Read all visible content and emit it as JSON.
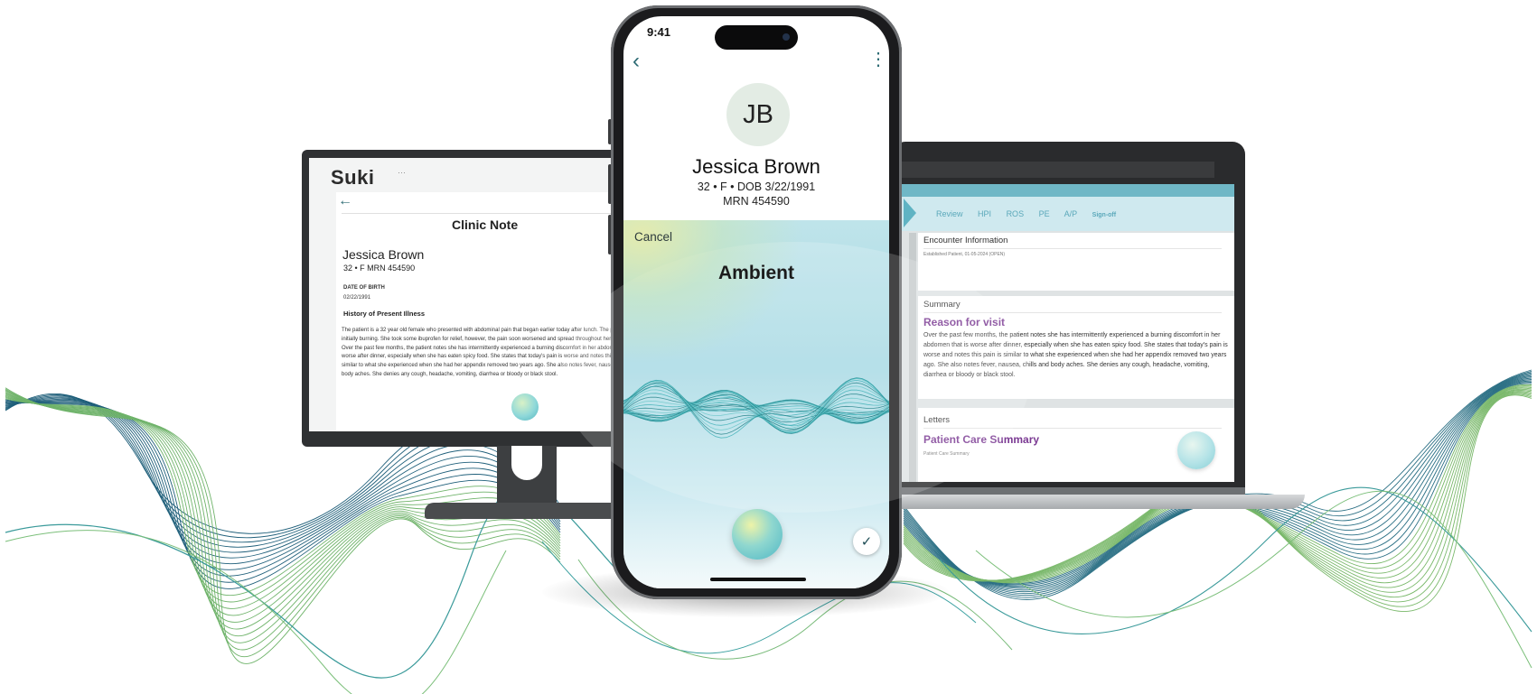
{
  "monitor": {
    "brand": "Suki",
    "menu_dots": "···",
    "note_title": "Clinic Note",
    "patient_name": "Jessica Brown",
    "patient_meta": "32 • F   MRN 454590",
    "dob_label": "DATE OF BIRTH",
    "dob_value": "02/22/1991",
    "section_title": "History of Present Illness",
    "section_body": "The patient is a 32 year old female who presented with abdominal pain that began earlier today after lunch. The pain was initially burning. She took some ibuprofen for relief, however, the pain soon worsened and spread throughout her abdomen. Over the past few months, the patient notes she has intermittently experienced a burning discomfort in her abdomen that is worse after dinner, especially when she has eaten spicy food. She states that today's pain is worse and notes this pain is similar to what she experienced when she had her appendix removed two years ago. She also notes fever, nausea, chills and body aches. She denies any cough, headache, vomiting, diarrhea or bloody or black stool."
  },
  "phone": {
    "status_time": "9:41",
    "avatar_initials": "JB",
    "patient_name": "Jessica Brown",
    "patient_meta": "32 • F • DOB 3/22/1991",
    "mrn": "MRN 454590",
    "cancel_label": "Cancel",
    "mode_title": "Ambient",
    "check_glyph": "✓",
    "back_glyph": "‹",
    "more_glyph": "⋮"
  },
  "laptop": {
    "nav_steps": [
      "Review",
      "HPI",
      "ROS",
      "PE",
      "A/P"
    ],
    "nav_sign_off": "Sign-off",
    "encounter_title": "Encounter Information",
    "encounter_sub": "Established Patient, 01-05-2024 (OPEN)",
    "summary_title": "Summary",
    "reason_title": "Reason for visit",
    "reason_body": "Over the past few months, the patient notes she has intermittently experienced a burning discomfort in her abdomen that is worse after dinner, especially when she has eaten spicy food. She states  that today's pain is worse and notes this pain is similar to what she experienced when she had her appendix removed two years ago.  She also notes fever, nausea, chills and body aches. She denies any cough, headache, vomiting, diarrhea or bloody or black stool.",
    "letters_title": "Letters",
    "letter_heading": "Patient Care Summary",
    "letter_sub": "Patient Care Summary"
  },
  "colors": {
    "accent_teal": "#2d6b74",
    "heading_purple": "#7b3a93",
    "nav_blue": "#5aa8ba"
  }
}
